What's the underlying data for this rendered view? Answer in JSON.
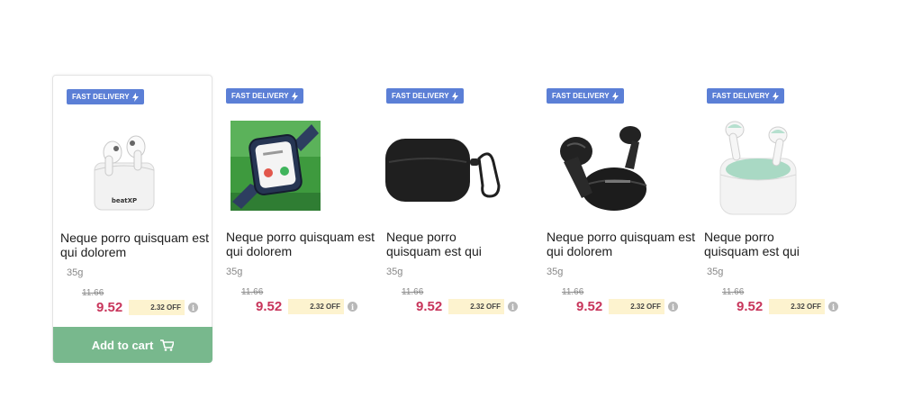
{
  "colors": {
    "badge": "#5b7fd6",
    "price": "#c8355b",
    "discount_bg": "#fdf3cf",
    "cart_button": "#78b88d"
  },
  "products": [
    {
      "badge": "FAST DELIVERY",
      "badge_icon": "bolt-icon",
      "image": "white-earbuds-case",
      "title": "Neque porro quisquam est qui dolorem",
      "weight": "35g",
      "mrp": "11.66",
      "price": "9.52",
      "discount": "2.32 OFF",
      "info_icon": "info-icon",
      "cart_label": "Add to cart",
      "cart_icon": "cart-icon"
    },
    {
      "badge": "FAST DELIVERY",
      "badge_icon": "bolt-icon",
      "image": "smartwatch",
      "title": "Neque porro quisquam est qui dolorem",
      "weight": "35g",
      "mrp": "11.66",
      "price": "9.52",
      "discount": "2.32 OFF",
      "info_icon": "info-icon"
    },
    {
      "badge": "FAST DELIVERY",
      "badge_icon": "bolt-icon",
      "image": "black-earbuds-cover",
      "title": "Neque porro quisquam est qui",
      "weight": "35g",
      "mrp": "11.66",
      "price": "9.52",
      "discount": "2.32 OFF",
      "info_icon": "info-icon"
    },
    {
      "badge": "FAST DELIVERY",
      "badge_icon": "bolt-icon",
      "image": "black-earbuds",
      "title": "Neque porro quisquam est qui dolorem",
      "weight": "35g",
      "mrp": "11.66",
      "price": "9.52",
      "discount": "2.32 OFF",
      "info_icon": "info-icon"
    },
    {
      "badge": "FAST DELIVERY",
      "badge_icon": "bolt-icon",
      "image": "white-mint-earbuds",
      "title": "Neque porro quisquam est qui",
      "weight": "35g",
      "mrp": "11.66",
      "price": "9.52",
      "discount": "2.32 OFF",
      "info_icon": "info-icon"
    }
  ]
}
